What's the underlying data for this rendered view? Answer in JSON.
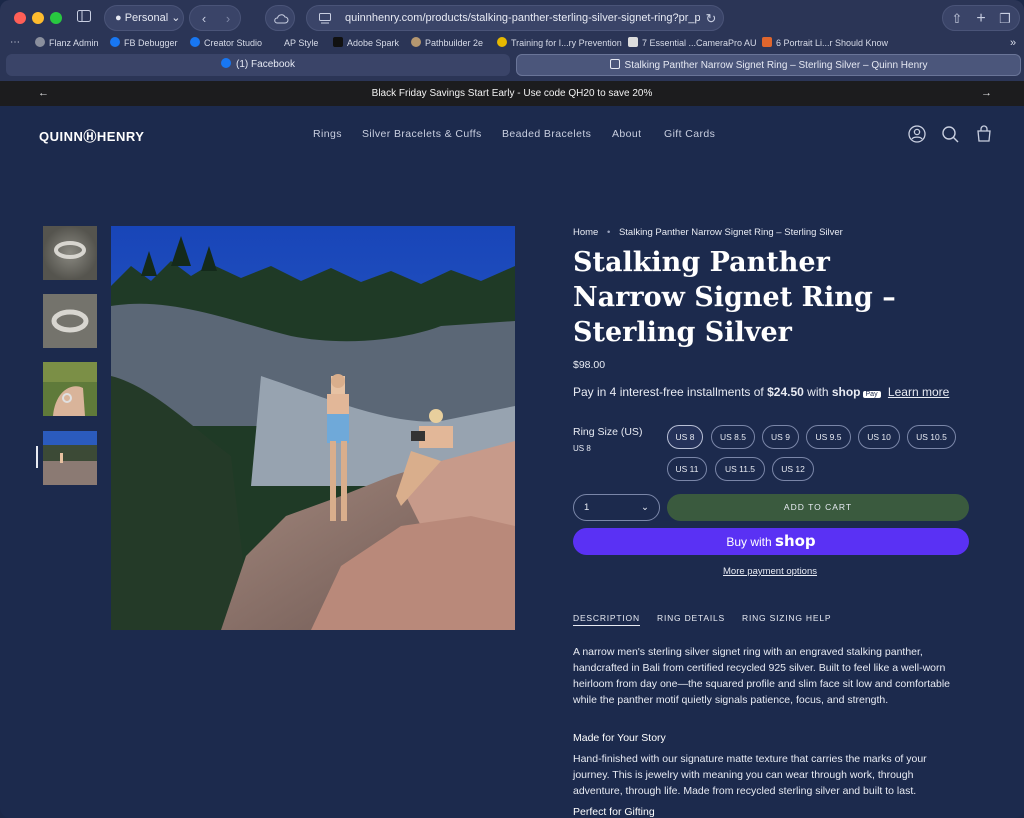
{
  "browser": {
    "profile": "Personal",
    "url": "quinnhenry.com/products/stalking-panther-sterling-silver-signet-ring?pr_prod_st",
    "bookmarks": [
      "Flanz Admin",
      "FB Debugger",
      "Creator Studio",
      "AP Style",
      "Adobe Spark",
      "Pathbuilder 2e",
      "Training for I...ry Prevention",
      "7 Essential ...CameraPro AU",
      "6 Portrait Li...r Should Know"
    ],
    "tabs": [
      "(1) Facebook",
      "Stalking Panther Narrow Signet Ring – Sterling Silver – Quinn Henry"
    ]
  },
  "announcement": "Black Friday Savings Start Early - Use code QH20 to save 20%",
  "header": {
    "logo": "QUINNⒽHENRY",
    "menu": [
      "Rings",
      "Silver Bracelets & Cuffs",
      "Beaded Bracelets",
      "About",
      "Gift Cards"
    ]
  },
  "product": {
    "breadcrumb_home": "Home",
    "breadcrumb_sep": "•",
    "breadcrumb_current": "Stalking Panther Narrow Signet Ring – Sterling Silver",
    "title": "Stalking Panther Narrow Signet Ring – Sterling Silver",
    "price": "$98.00",
    "installment_prefix": "Pay in 4 interest-free installments of",
    "installment_amount": "$24.50",
    "installment_with": "with",
    "shop_pay": "shop",
    "shop_pay_badge": "Pay",
    "learn_more": "Learn more",
    "size_label": "Ring Size (US)",
    "size_selected": "US 8",
    "sizes": [
      "US 8",
      "US 8.5",
      "US 9",
      "US 9.5",
      "US 10",
      "US 10.5",
      "US 11",
      "US 11.5",
      "US 12"
    ],
    "quantity": "1",
    "add_to_cart": "ADD TO CART",
    "buy_with": "Buy with",
    "buy_shop": "shop",
    "more_payment": "More payment options",
    "tabs": [
      "DESCRIPTION",
      "RING DETAILS",
      "RING SIZING HELP"
    ],
    "description": "A narrow men's sterling silver signet ring with an engraved stalking panther, handcrafted in Bali from certified recycled 925 silver. Built to feel like a well-worn heirloom from day one—the squared profile and slim face sit low and comfortable while the panther motif quietly signals patience, focus, and strength.",
    "story_heading": "Made for Your Story",
    "story_text": "Hand-finished with our signature matte texture that carries the marks of your journey. This is jewelry with meaning you can wear through work, through adventure, through life. Made from recycled sterling silver and built to last.",
    "gift_heading": "Perfect for Gifting"
  }
}
